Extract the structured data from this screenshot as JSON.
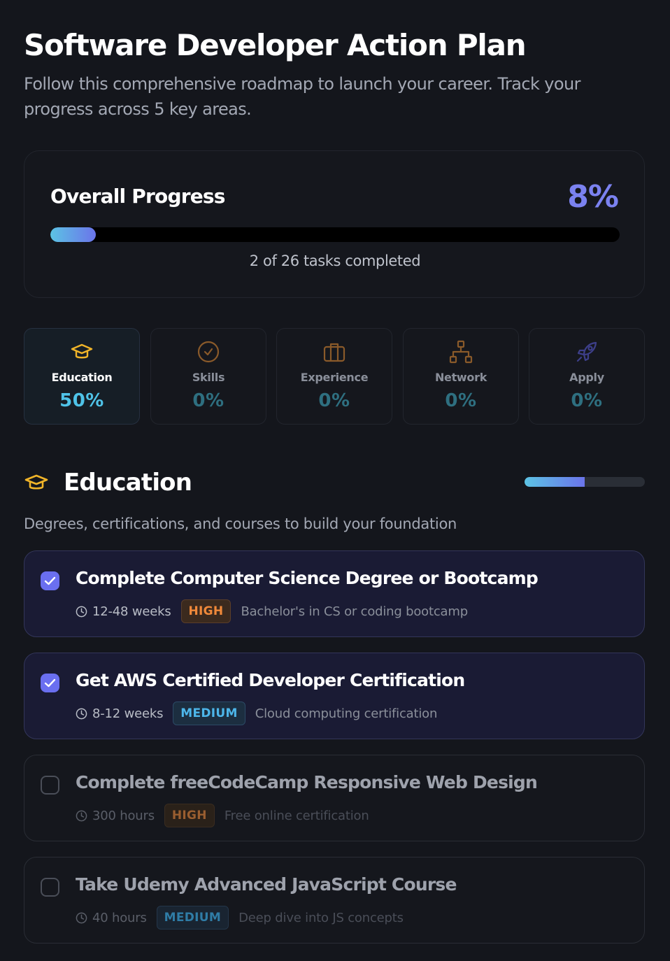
{
  "header": {
    "title": "Software Developer Action Plan",
    "subtitle": "Follow this comprehensive roadmap to launch your career. Track your progress across 5 key areas."
  },
  "overall": {
    "label": "Overall Progress",
    "percent_text": "8%",
    "progress_fraction": 0.08,
    "count_text": "2 of 26 tasks completed"
  },
  "categories": [
    {
      "name": "Education",
      "percent_text": "50%",
      "icon": "graduation-cap-icon",
      "active": true
    },
    {
      "name": "Skills",
      "percent_text": "0%",
      "icon": "check-circle-icon",
      "active": false
    },
    {
      "name": "Experience",
      "percent_text": "0%",
      "icon": "briefcase-icon",
      "active": false
    },
    {
      "name": "Network",
      "percent_text": "0%",
      "icon": "network-icon",
      "active": false
    },
    {
      "name": "Apply",
      "percent_text": "0%",
      "icon": "rocket-icon",
      "active": false
    }
  ],
  "section": {
    "title": "Education",
    "description": "Degrees, certifications, and courses to build your foundation",
    "progress_fraction": 0.5,
    "icon": "graduation-cap-icon"
  },
  "tasks": [
    {
      "title": "Complete Computer Science Degree or Bootcamp",
      "duration": "12-48 weeks",
      "priority": "HIGH",
      "note": "Bachelor's in CS or coding bootcamp",
      "completed": true
    },
    {
      "title": "Get AWS Certified Developer Certification",
      "duration": "8-12 weeks",
      "priority": "MEDIUM",
      "note": "Cloud computing certification",
      "completed": true
    },
    {
      "title": "Complete freeCodeCamp Responsive Web Design",
      "duration": "300 hours",
      "priority": "HIGH",
      "note": "Free online certification",
      "completed": false
    },
    {
      "title": "Take Udemy Advanced JavaScript Course",
      "duration": "40 hours",
      "priority": "MEDIUM",
      "note": "Deep dive into JS concepts",
      "completed": false
    }
  ],
  "colors": {
    "background": "#14161c",
    "accent": "#7b82f0",
    "cyan": "#4fc3e8",
    "education_gold": "#f0b429",
    "high": "#f0893a",
    "medium": "#4db6ea"
  }
}
